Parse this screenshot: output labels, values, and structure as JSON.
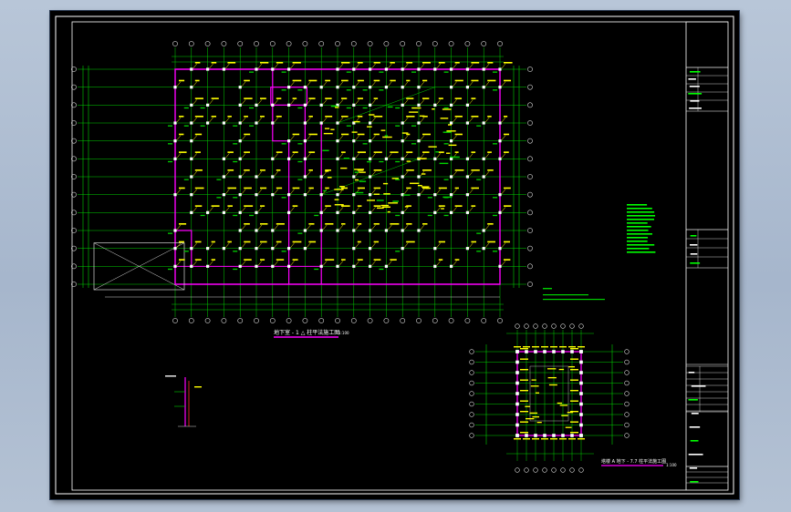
{
  "drawing": {
    "main_plan_title": "地下室 - 1 △ 柱平法施工图",
    "main_plan_scale": "1:100",
    "tower_plan_title": "塔楼 A 地下 - 7.7 柱平法施工图",
    "tower_plan_scale": "1:100"
  },
  "colors": {
    "background": "#000000",
    "grid_lines": "#00d200",
    "axis_bubbles": "#d8d8d8",
    "columns": "#ffffff",
    "annotations": "#ffff00",
    "walls": "#ff00ff",
    "border": "#ffffff",
    "title_block": "#00ff00"
  }
}
